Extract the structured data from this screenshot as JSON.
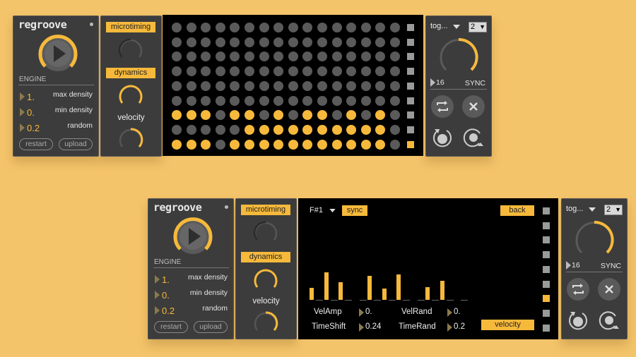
{
  "colors": {
    "accent": "#f6b93b",
    "panel": "#3c3c3c",
    "dot_off": "#5a5a5a",
    "background": "#f4c46a"
  },
  "logo": "regroove",
  "engine": {
    "label": "ENGINE",
    "params": [
      {
        "value": "1.",
        "label": "max density"
      },
      {
        "value": "0.",
        "label": "min density"
      },
      {
        "value": "0.2",
        "label": "random"
      }
    ],
    "restart": "restart",
    "upload": "upload"
  },
  "controls": {
    "microtiming": "microtiming",
    "dynamics": "dynamics",
    "velocity": "velocity"
  },
  "side": {
    "mode": "tog...",
    "number": "2",
    "steps": "16",
    "sync": "SYNC"
  },
  "grid_top": {
    "rows": [
      "0000000000000000",
      "0000000000000000",
      "0000000000000000",
      "0000000000000000",
      "0000000000000000",
      "0000000000000000",
      "1110110101101010",
      "0000011111111110",
      "1110111111111110"
    ],
    "squares_on": [
      8
    ]
  },
  "editor": {
    "note": "F#1",
    "sync": "sync",
    "back": "back",
    "bars": [
      0.38,
      0.85,
      0.55,
      0,
      0.75,
      0.35,
      0.78,
      0,
      0.4,
      0.58,
      0
    ],
    "params": [
      {
        "label": "VelAmp",
        "value": "0."
      },
      {
        "label": "VelRand",
        "value": "0."
      },
      {
        "label": "TimeShift",
        "value": "0.24"
      },
      {
        "label": "TimeRand",
        "value": "0.2"
      }
    ],
    "velocity_tag": "velocity",
    "squares_on": [
      6
    ]
  }
}
